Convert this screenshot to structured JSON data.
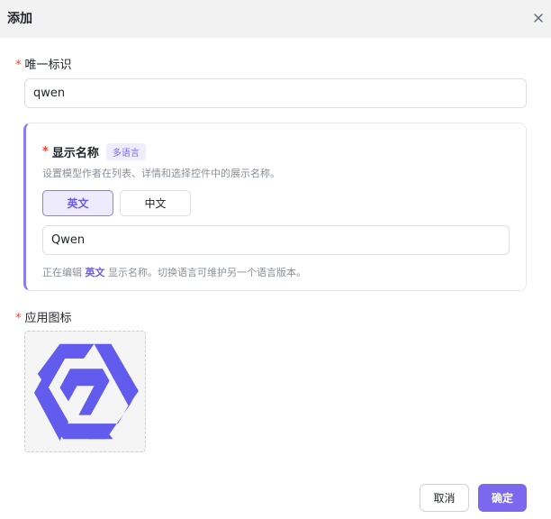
{
  "dialog": {
    "title": "添加",
    "close_icon": "close-icon"
  },
  "fields": {
    "unique_id": {
      "required_mark": "*",
      "label": "唯一标识",
      "value": "qwen"
    },
    "display_name": {
      "required_mark": "*",
      "label": "显示名称",
      "badge": "多语言",
      "description": "设置模型作者在列表、详情和选择控件中的展示名称。",
      "languages": [
        "英文",
        "中文"
      ],
      "selected_language": "英文",
      "value": "Qwen",
      "editing_prefix": "正在编辑",
      "editing_language": "英文",
      "editing_suffix": "显示名称。切换语言可维护另一个语言版本。"
    },
    "app_icon": {
      "required_mark": "*",
      "label": "应用图标",
      "icon": "qwen-logo"
    }
  },
  "footer": {
    "cancel_label": "取消",
    "confirm_label": "确定"
  },
  "colors": {
    "accent": "#7b68ee",
    "required": "#f04438",
    "logo": "#615ced"
  }
}
